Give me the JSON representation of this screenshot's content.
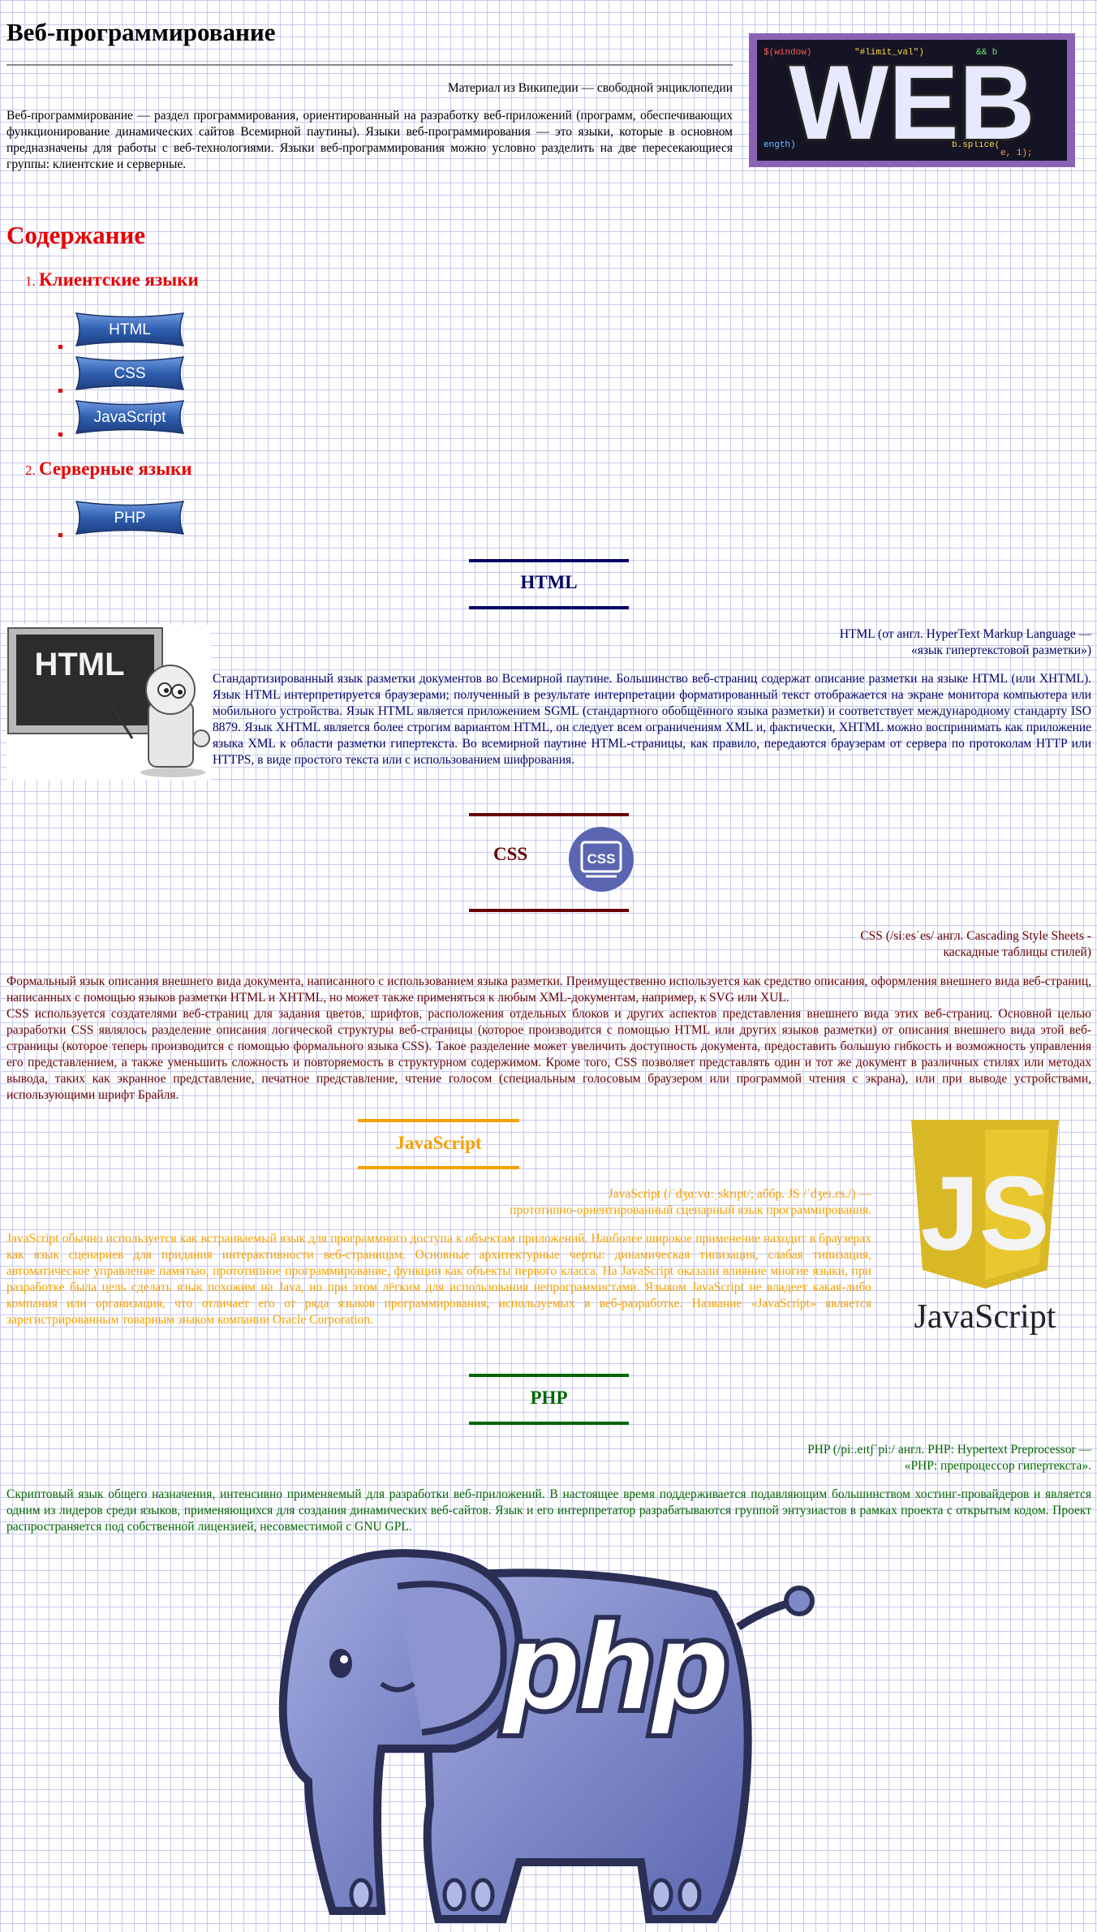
{
  "header": {
    "title": "Веб-программирование",
    "source": "Материал из Википедии — свободной энциклопедии",
    "intro": "Веб-программирование — раздел программирования, ориентированный на разработку веб-приложений (программ, обеспечивающих функционирование динамических сайтов Всемирной паутины). Языки веб-программирования — это языки, которые в основном предназначены для работы с веб-технологиями. Языки веб-программирования можно условно разделить на две пересекающиеся группы: клиентские и серверные.",
    "image_text": "WEB"
  },
  "toc": {
    "title": "Содержание",
    "groups": [
      {
        "num": "1.",
        "label": "Клиентские языки",
        "items": [
          "HTML",
          "CSS",
          "JavaScript"
        ]
      },
      {
        "num": "2.",
        "label": "Серверные языки",
        "items": [
          "PHP"
        ]
      }
    ]
  },
  "sections": {
    "html": {
      "heading": "HTML",
      "image_text": "HTML",
      "definition_line1": "HTML (от англ. HyperText Markup Language —",
      "definition_line2": "«язык гипертекстовой разметки»)",
      "text": "Стандартизированный язык разметки документов во Всемирной паутине. Большинство веб-страниц содержат описание разметки на языке HTML (или XHTML). Язык HTML интерпретируется браузерами; полученный в результате интерпретации форматированный текст отображается на экране монитора компьютера или мобильного устройства. Язык HTML является приложением SGML (стандартного обобщённого языка разметки) и соответствует международному стандарту ISO 8879. Язык XHTML является более строгим вариантом HTML, он следует всем ограничениям XML и, фактически, XHTML можно воспринимать как приложение языка XML к области разметки гипертекста. Во всемирной паутине HTML-страницы, как правило, передаются браузерам от сервера по протоколам HTTP или HTTPS, в виде простого текста или с использованием шифрования."
    },
    "css": {
      "heading": "CSS",
      "logo_text": "CSS",
      "definition_line1": "CSS (/siːesˈes/ англ. Cascading Style Sheets -",
      "definition_line2": "каскадные таблицы стилей)",
      "text1": "Формальный язык описания внешнего вида документа, написанного с использованием языка разметки. Преимущественно используется как средство описания, оформления внешнего вида веб-страниц, написанных с помощью языков разметки HTML и XHTML, но может также применяться к любым XML-документам, например, к SVG или XUL.",
      "text2": "CSS используется создателями веб-страниц для задания цветов, шрифтов, расположения отдельных блоков и других аспектов представления внешнего вида этих веб-страниц. Основной целью разработки CSS являлось разделение описания логической структуры веб-страницы (которое производится с помощью HTML или других языков разметки) от описания внешнего вида этой веб-страницы (которое теперь производится с помощью формального языка CSS). Такое разделение может увеличить доступность документа, предоставить большую гибкость и возможность управления его представлением, а также уменьшить сложность и повторяемость в структурном содержимом. Кроме того, CSS позволяет представлять один и тот же документ в различных стилях или методах вывода, таких как экранное представление, печатное представление, чтение голосом (специальным голосовым браузером или программой чтения с экрана), или при выводе устройствами, использующими шрифт Брайля."
    },
    "js": {
      "heading": "JavaScript",
      "logo_letters": "JS",
      "logo_caption": "JavaScript",
      "definition_line1": "JavaScript (/ˈdʒɑːvɑːˌskrɪpt/; аббр. JS /ˈdʒeɪ.ɛs./) —",
      "definition_line2": "прототипно-ориентированный сценарный язык программирования.",
      "text": "JavaScript обычно используется как встраиваемый язык для программного доступа к объектам приложений. Наиболее широкое применение находит в браузерах как язык сценариев для придания интерактивности веб-страницам. Основные архитектурные черты: динамическая типизация, слабая типизация, автоматическое управление памятью, прототипное программирование, функции как объекты первого класса. На JavaScript оказали влияние многие языки, при разработке была цель сделать язык похожим на Java, но при этом лёгким для использования непрограммистами. Языком JavaScript не владеет какая-либо компания или организация, что отличает его от ряда языков программирования, используемых в веб-разработке. Название «JavaScript» является зарегистрированным товарным знаком компании Oracle Corporation."
    },
    "php": {
      "heading": "PHP",
      "logo_text": "php",
      "definition_line1": "PHP (/piː.eɪtʃˈpiː/ англ. PHP: Hypertext Preprocessor —",
      "definition_line2": "«PHP: препроцессор гипертекста».",
      "text": "Скриптовый язык общего назначения, интенсивно применяемый для разработки веб-приложений. В настоящее время поддерживается подавляющим большинством хостинг-провайдеров и является одним из лидеров среди языков, применяющихся для создания динамических веб-сайтов. Язык и его интерпретатор разрабатываются группой энтузиастов в рамках проекта с открытым кодом. Проект распространяется под собственной лицензией, несовместимой с GNU GPL."
    }
  },
  "colors": {
    "toc": "#e60000",
    "html": "#000066",
    "css": "#660000",
    "js": "#f5a000",
    "php": "#006600",
    "button": "#2f5fb0"
  }
}
